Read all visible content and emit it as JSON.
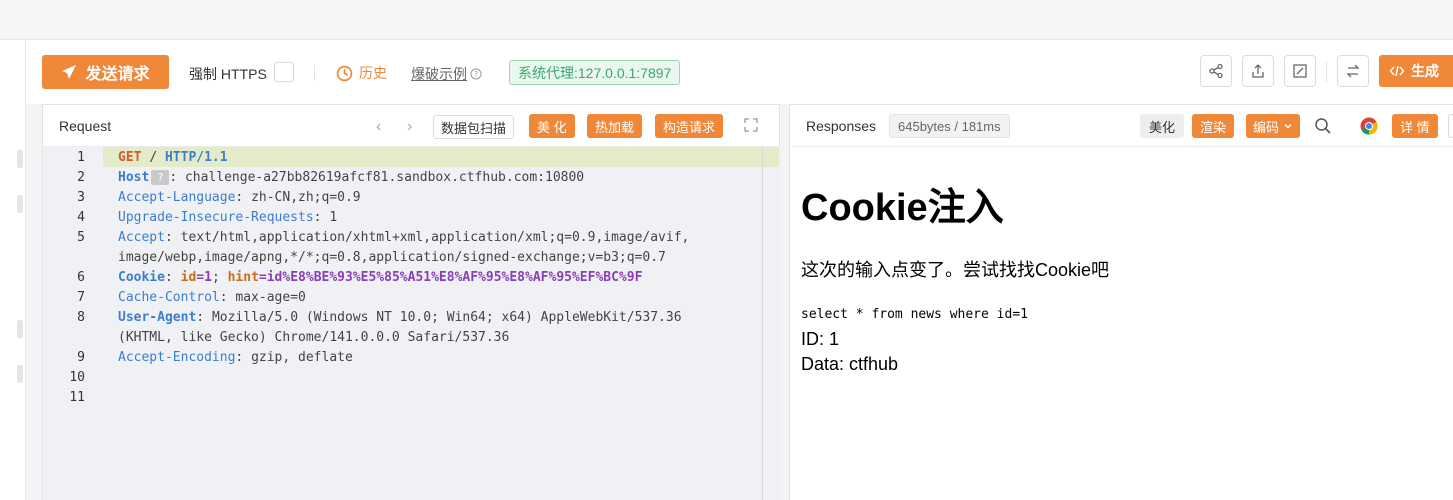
{
  "toolbar": {
    "send_label": "发送请求",
    "https_label": "强制 HTTPS",
    "history_label": "历史",
    "blast_label": "爆破示例",
    "proxy_label": "系统代理:127.0.0.1:7897",
    "generate_label": "生成"
  },
  "request": {
    "title": "Request",
    "scan_label": "数据包扫描",
    "beautify_label": "美 化",
    "hotload_label": "热加载",
    "construct_label": "构造请求",
    "line_numbers": [
      "1",
      "2",
      "3",
      "4",
      "5",
      "",
      "6",
      "7",
      "8",
      "",
      "9",
      "10",
      "11"
    ],
    "lines": {
      "l1": {
        "method": "GET",
        "path": "/",
        "proto": "HTTP/1.1"
      },
      "l2": {
        "key": "Host",
        "badge": "?",
        "value": "challenge-a27bb82619afcf81.sandbox.ctfhub.com:10800"
      },
      "l3": {
        "key": "Accept-Language",
        "value": "zh-CN,zh;q=0.9"
      },
      "l4": {
        "key": "Upgrade-Insecure-Requests",
        "value": "1"
      },
      "l5": {
        "key": "Accept",
        "value": "text/html,application/xhtml+xml,application/xml;q=0.9,image/avif,",
        "cont": "image/webp,image/apng,*/*;q=0.8,application/signed-exchange;v=b3;q=0.7"
      },
      "l6": {
        "key": "Cookie",
        "c1k": "id",
        "c1v": "=1",
        "c2k": "hint",
        "c2v": "=id%E8%BE%93%E5%85%A51%E8%AF%95%E8%AF%95%EF%BC%9F"
      },
      "l7": {
        "key": "Cache-Control",
        "value": "max-age=0"
      },
      "l8": {
        "key": "User-Agent",
        "value": "Mozilla/5.0 (Windows NT 10.0; Win64; x64) AppleWebKit/537.36",
        "cont": "(KHTML, like Gecko) Chrome/141.0.0.0 Safari/537.36"
      },
      "l9": {
        "key": "Accept-Encoding",
        "value": "gzip, deflate"
      }
    }
  },
  "response": {
    "title": "Responses",
    "size_label": "645bytes / 181ms",
    "beautify_label": "美化",
    "render_label": "渲染",
    "encode_label": "编码",
    "detail_label": "详 情",
    "heading": "Cookie注入",
    "paragraph": "这次的输入点变了。尝试找找Cookie吧",
    "sql": "select * from news where id=1",
    "id_line": "ID: 1",
    "data_line": "Data: ctfhub"
  },
  "colors": {
    "accent": "#f0883a",
    "proxy_green": "#3aa86c",
    "highlight": "#e4ebc8"
  },
  "icons": [
    "paper-plane-icon",
    "clock-icon",
    "help-circle-icon",
    "share-icon",
    "upload-icon",
    "edit-icon",
    "swap-icon",
    "code-icon",
    "chevron-left-icon",
    "chevron-right-icon",
    "expand-icon",
    "chevron-down-icon",
    "search-icon",
    "chrome-icon"
  ]
}
